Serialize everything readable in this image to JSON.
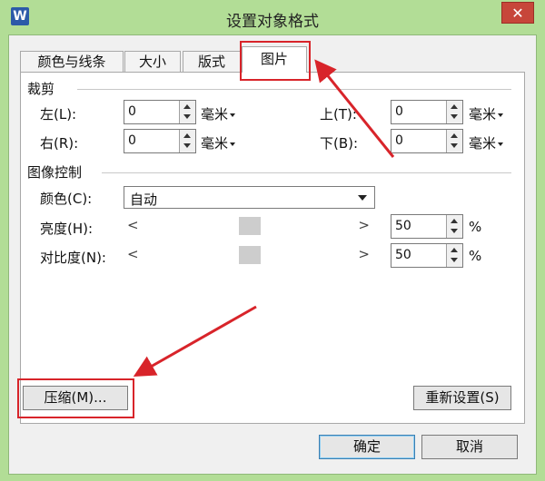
{
  "window": {
    "title": "设置对象格式",
    "app_icon": "W",
    "close_glyph": "✕"
  },
  "tabs": [
    {
      "label": "颜色与线条"
    },
    {
      "label": "大小"
    },
    {
      "label": "版式"
    },
    {
      "label": "图片",
      "active": true
    }
  ],
  "crop": {
    "group_label": "裁剪",
    "left": {
      "label": "左(L):",
      "value": "0",
      "unit": "毫米"
    },
    "right": {
      "label": "右(R):",
      "value": "0",
      "unit": "毫米"
    },
    "top": {
      "label": "上(T):",
      "value": "0",
      "unit": "毫米"
    },
    "bottom": {
      "label": "下(B):",
      "value": "0",
      "unit": "毫米"
    }
  },
  "image_control": {
    "group_label": "图像控制",
    "color": {
      "label": "颜色(C):",
      "value": "自动"
    },
    "brightness": {
      "label": "亮度(H):",
      "value": "50",
      "unit": "%",
      "left_glyph": "<",
      "right_glyph": ">"
    },
    "contrast": {
      "label": "对比度(N):",
      "value": "50",
      "unit": "%",
      "left_glyph": "<",
      "right_glyph": ">"
    }
  },
  "buttons": {
    "compress": "压缩(M)...",
    "reset": "重新设置(S)",
    "ok": "确定",
    "cancel": "取消"
  },
  "colors": {
    "annotation": "#d8242a",
    "window_frame": "#b2dd96"
  }
}
